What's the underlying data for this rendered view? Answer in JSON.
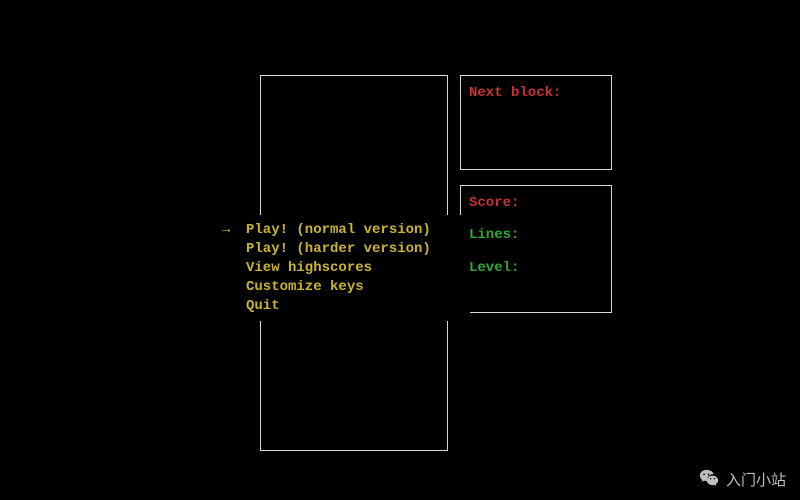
{
  "panels": {
    "next_label": "Next block:",
    "stats": {
      "score_label": "Score:",
      "lines_label": "Lines:",
      "level_label": "Level:"
    }
  },
  "menu": {
    "arrow_glyph": "→",
    "items": [
      {
        "label": "Play! (normal version)",
        "selected": true
      },
      {
        "label": "Play! (harder version)",
        "selected": false
      },
      {
        "label": "View highscores",
        "selected": false
      },
      {
        "label": "Customize keys",
        "selected": false
      },
      {
        "label": "Quit",
        "selected": false
      }
    ]
  },
  "watermark": {
    "text": "入门小站"
  }
}
